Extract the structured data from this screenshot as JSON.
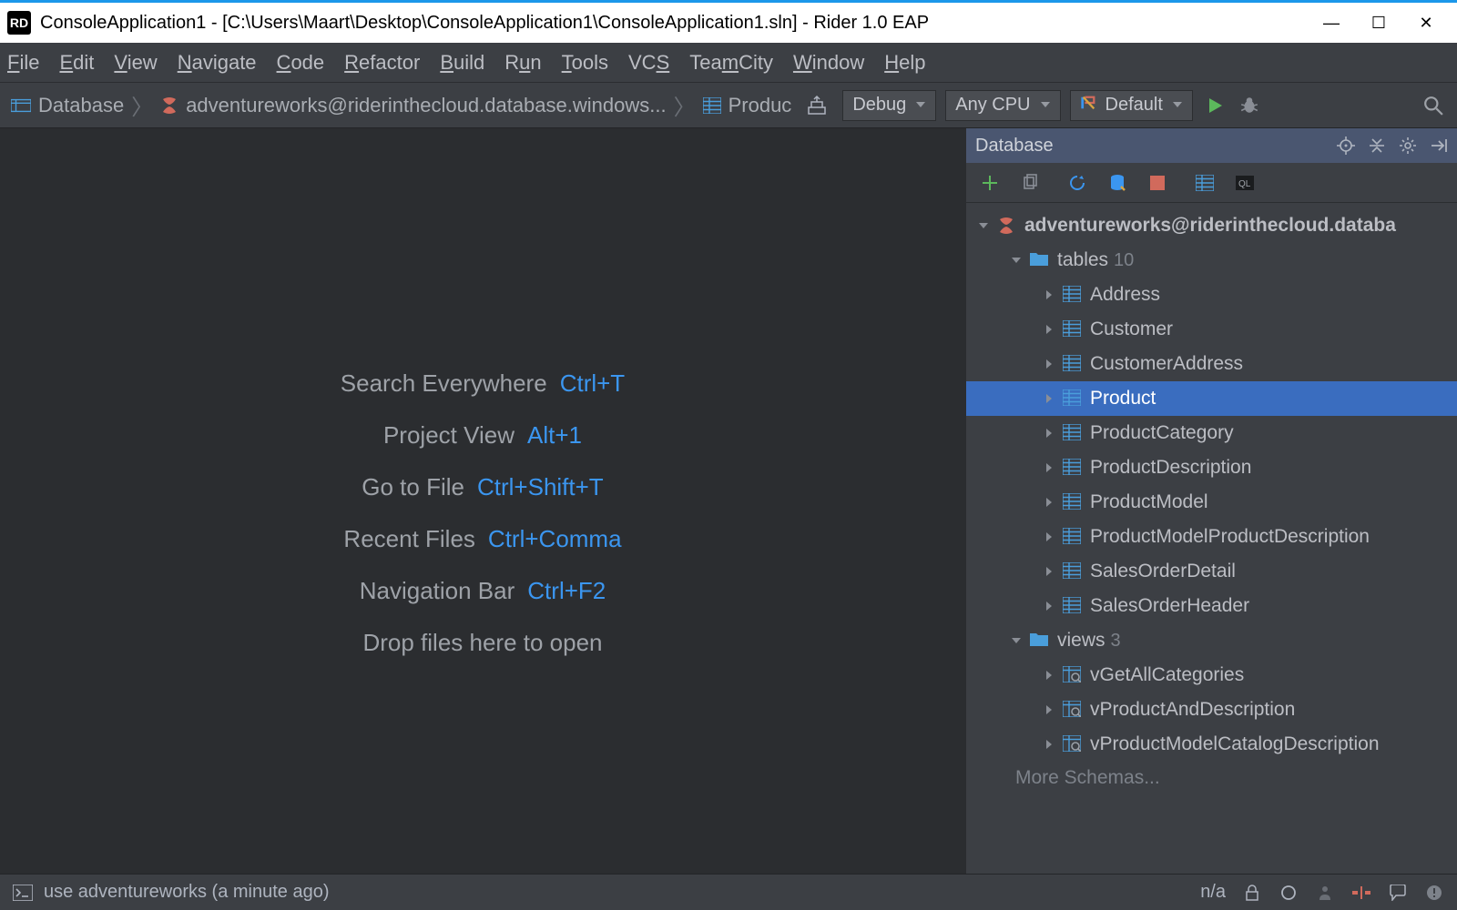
{
  "titlebar": {
    "app_icon_text": "RD",
    "title": "ConsoleApplication1 - [C:\\Users\\Maart\\Desktop\\ConsoleApplication1\\ConsoleApplication1.sln] - Rider 1.0 EAP"
  },
  "menu": {
    "items": [
      "File",
      "Edit",
      "View",
      "Navigate",
      "Code",
      "Refactor",
      "Build",
      "Run",
      "Tools",
      "VCS",
      "TeamCity",
      "Window",
      "Help"
    ],
    "mnemonics": [
      "F",
      "E",
      "V",
      "N",
      "C",
      "R",
      "B",
      "u",
      "T",
      "S",
      "m",
      "W",
      "H"
    ]
  },
  "breadcrumbs": {
    "database": "Database",
    "connection": "adventureworks@riderinthecloud.database.windows...",
    "table": "Produc"
  },
  "runconfig": {
    "config": "Debug",
    "platform": "Any CPU",
    "target": "Default"
  },
  "welcome": {
    "rows": [
      {
        "label": "Search Everywhere",
        "key": "Ctrl+T"
      },
      {
        "label": "Project View",
        "key": "Alt+1"
      },
      {
        "label": "Go to File",
        "key": "Ctrl+Shift+T"
      },
      {
        "label": "Recent Files",
        "key": "Ctrl+Comma"
      },
      {
        "label": "Navigation Bar",
        "key": "Ctrl+F2"
      }
    ],
    "drop": "Drop files here to open"
  },
  "dbpanel": {
    "title": "Database",
    "connection": "adventureworks@riderinthecloud.databa",
    "tables_label": "tables",
    "tables_count": "10",
    "tables": [
      "Address",
      "Customer",
      "CustomerAddress",
      "Product",
      "ProductCategory",
      "ProductDescription",
      "ProductModel",
      "ProductModelProductDescription",
      "SalesOrderDetail",
      "SalesOrderHeader"
    ],
    "selected_table": "Product",
    "views_label": "views",
    "views_count": "3",
    "views": [
      "vGetAllCategories",
      "vProductAndDescription",
      "vProductModelCatalogDescription"
    ],
    "more": "More Schemas..."
  },
  "statusbar": {
    "msg": "use adventureworks (a minute ago)",
    "na": "n/a"
  }
}
